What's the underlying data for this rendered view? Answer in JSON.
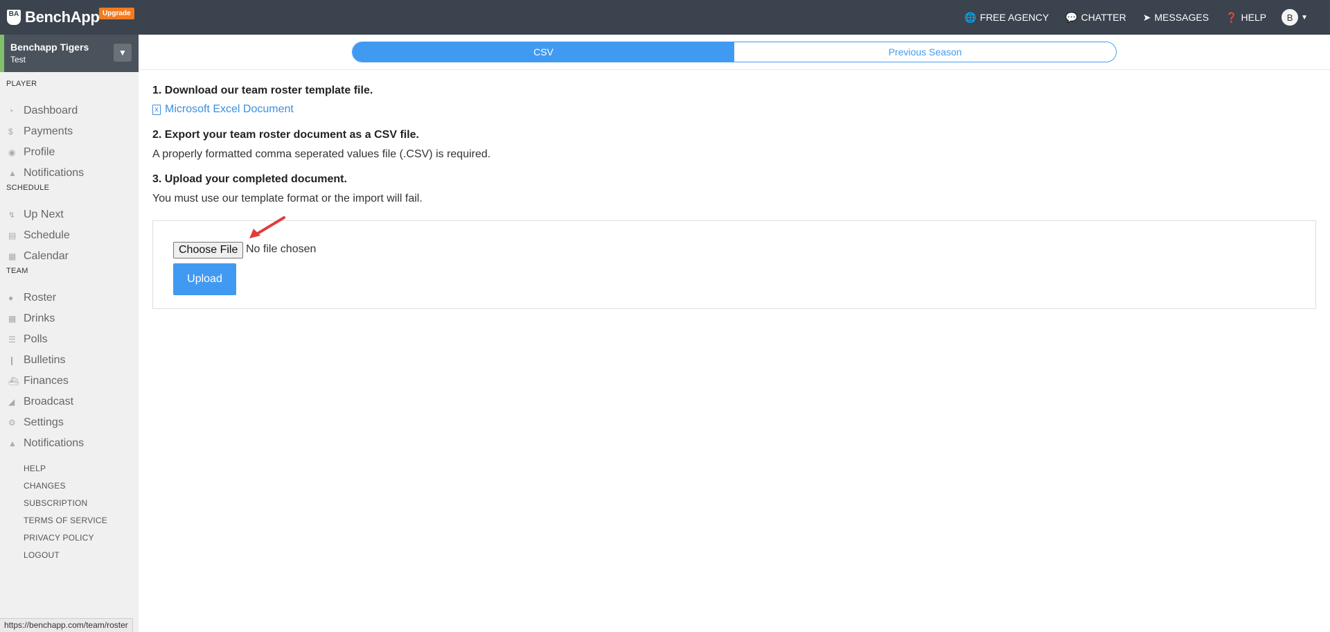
{
  "topbar": {
    "logo_badge": "BA",
    "logo_text": "BenchApp",
    "upgrade_label": "Upgrade",
    "nav": [
      {
        "label": "FREE AGENCY",
        "icon": "globe-icon"
      },
      {
        "label": "CHATTER",
        "icon": "chat-bubbles-icon"
      },
      {
        "label": "MESSAGES",
        "icon": "paper-plane-icon"
      },
      {
        "label": "HELP",
        "icon": "question-circle-icon"
      }
    ],
    "avatar_letter": "B"
  },
  "sidebar": {
    "team_name": "Benchapp Tigers",
    "team_sub": "Test",
    "sections": {
      "player": "PLAYER",
      "schedule": "SCHEDULE",
      "team": "TEAM"
    },
    "player_items": [
      {
        "label": "Dashboard",
        "icon": "dashboard-icon"
      },
      {
        "label": "Payments",
        "icon": "dollar-icon"
      },
      {
        "label": "Profile",
        "icon": "user-circle-icon"
      },
      {
        "label": "Notifications",
        "icon": "bell-icon"
      }
    ],
    "schedule_items": [
      {
        "label": "Up Next",
        "icon": "bolt-icon"
      },
      {
        "label": "Schedule",
        "icon": "list-icon"
      },
      {
        "label": "Calendar",
        "icon": "calendar-icon"
      }
    ],
    "team_items": [
      {
        "label": "Roster",
        "icon": "users-icon"
      },
      {
        "label": "Drinks",
        "icon": "beer-icon"
      },
      {
        "label": "Polls",
        "icon": "list-bullets-icon"
      },
      {
        "label": "Bulletins",
        "icon": "pin-icon"
      },
      {
        "label": "Finances",
        "icon": "bank-icon"
      },
      {
        "label": "Broadcast",
        "icon": "megaphone-icon"
      },
      {
        "label": "Settings",
        "icon": "cogs-icon"
      },
      {
        "label": "Notifications",
        "icon": "bell-icon"
      }
    ],
    "footer_links": [
      "HELP",
      "CHANGES",
      "SUBSCRIPTION",
      "TERMS OF SERVICE",
      "PRIVACY POLICY",
      "LOGOUT"
    ]
  },
  "status_url": "https://benchapp.com/team/roster",
  "main": {
    "tabs": [
      {
        "label": "CSV",
        "active": true
      },
      {
        "label": "Previous Season",
        "active": false
      }
    ],
    "step1_title": "1. Download our team roster template file.",
    "excel_link": "Microsoft Excel Document",
    "step2_title": "2. Export your team roster document as a CSV file.",
    "step2_text": "A properly formatted comma seperated values file (.CSV) is required.",
    "step3_title": "3. Upload your completed document.",
    "step3_text": "You must use our template format or the import will fail.",
    "choose_file_label": "Choose File",
    "file_status": "No file chosen",
    "upload_label": "Upload"
  },
  "colors": {
    "topbar": "#3a434e",
    "accent": "#419af2",
    "upgrade": "#f47b20",
    "team_stripe": "#83c06c"
  }
}
